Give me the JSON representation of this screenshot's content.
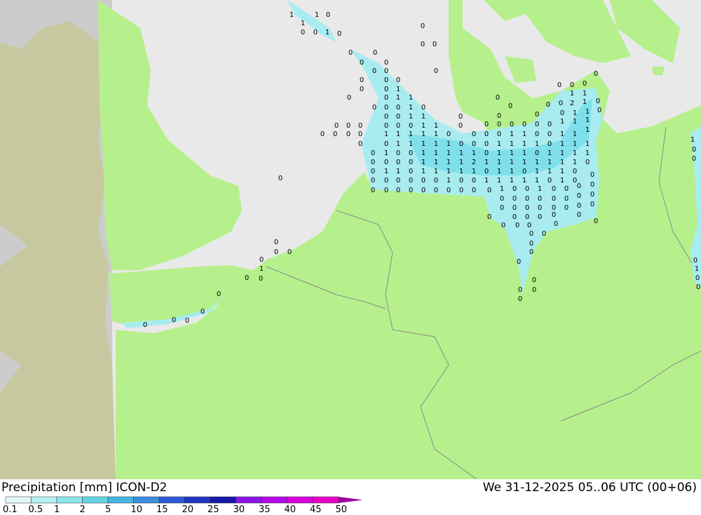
{
  "title": "Precipitation [mm] ICON-D2",
  "datetime": "We 31-12-2025 05..06 UTC (00+06)",
  "colors": {
    "sea": "#e9e9e9",
    "land_domain": "#b6f08c",
    "land_outside": "#c8c8a0",
    "sea_outside": "#cccccc",
    "precip_light": "#a8ecf0",
    "precip_medium": "#7fe0ec"
  },
  "legend": {
    "labels": [
      "0.1",
      "0.5",
      "1",
      "2",
      "5",
      "10",
      "15",
      "20",
      "25",
      "30",
      "35",
      "40",
      "45",
      "50"
    ],
    "colors": [
      "#e0f8f8",
      "#b4f0f0",
      "#8ce6ec",
      "#64d4e4",
      "#46b4e0",
      "#3c8ce0",
      "#2c5ad8",
      "#2034c0",
      "#1818a8",
      "#8c14e8",
      "#b40ae8",
      "#d800dc",
      "#e800c8",
      "#a000a0"
    ]
  },
  "grid_values": [
    {
      "row": "1 1 0"
    },
    {
      "row": "1 0 1 0"
    },
    {
      "row": "0 0 1 1 0 0 1 1 1 1 1 2 1 1 1 1"
    }
  ]
}
